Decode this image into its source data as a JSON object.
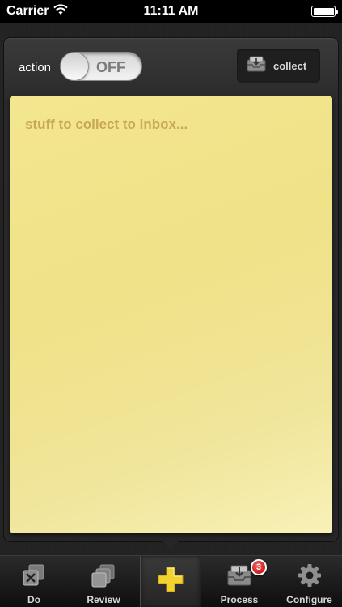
{
  "status_bar": {
    "carrier": "Carrier",
    "time": "11:11 AM"
  },
  "header": {
    "action_label": "action",
    "toggle_state": "OFF",
    "collect_label": "collect"
  },
  "note": {
    "placeholder": "stuff to collect to inbox..."
  },
  "tabbar": {
    "tabs": [
      {
        "label": "Do",
        "icon": "do-icon"
      },
      {
        "label": "Review",
        "icon": "review-icon"
      },
      {
        "label": "",
        "icon": "plus-icon",
        "active": true
      },
      {
        "label": "Process",
        "icon": "inbox-tray-icon",
        "badge": "3"
      },
      {
        "label": "Configure",
        "icon": "gear-icon"
      }
    ]
  },
  "colors": {
    "note_bg": "#efe287",
    "placeholder": "#c9a85a",
    "badge": "#d01515",
    "plus": "#f2d22e"
  }
}
